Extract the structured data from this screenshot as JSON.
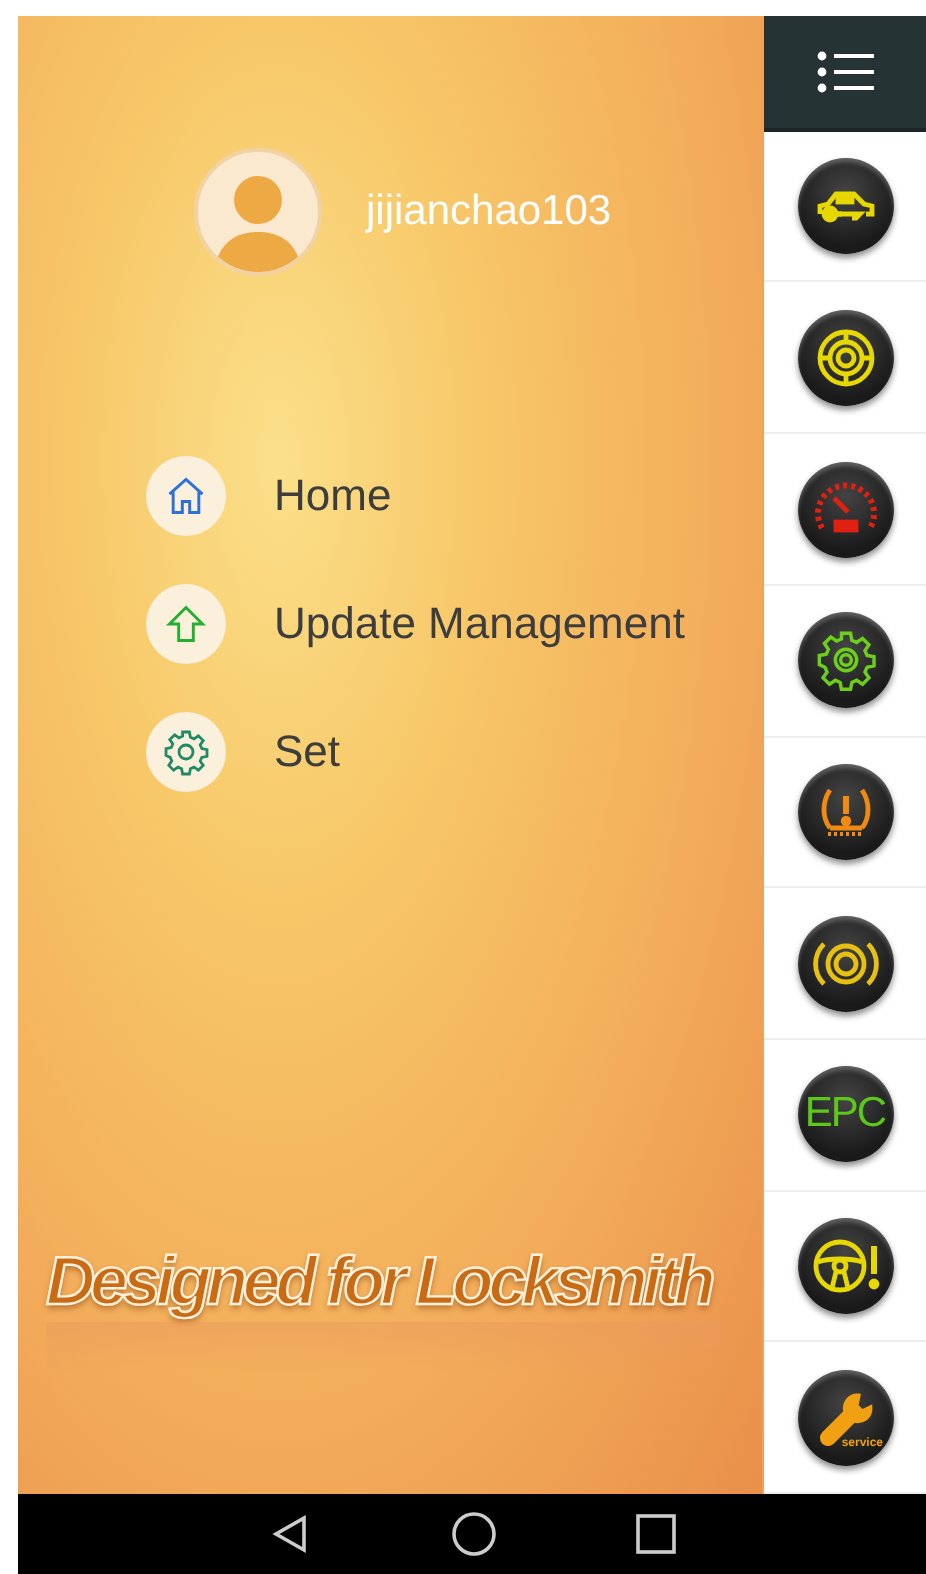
{
  "drawer": {
    "username": "jijianchao103",
    "menu": [
      {
        "kind": "home",
        "label": "Home"
      },
      {
        "kind": "update",
        "label": "Update Management"
      },
      {
        "kind": "settings",
        "label": "Set"
      }
    ],
    "slogan": "Designed for Locksmith"
  },
  "sidebar": {
    "items": [
      {
        "kind": "car-key",
        "color": "#e6d800"
      },
      {
        "kind": "tire",
        "color": "#e6d800"
      },
      {
        "kind": "speedometer",
        "color": "#e02010"
      },
      {
        "kind": "gear",
        "color": "#6ccf1a"
      },
      {
        "kind": "tire-pressure",
        "color": "#f08a10"
      },
      {
        "kind": "brake",
        "color": "#e8c010"
      },
      {
        "kind": "epc",
        "color": "#5cc81a",
        "text": "EPC"
      },
      {
        "kind": "steering",
        "color": "#e6d800"
      },
      {
        "kind": "service",
        "color": "#f0a010",
        "text": "service"
      }
    ]
  }
}
